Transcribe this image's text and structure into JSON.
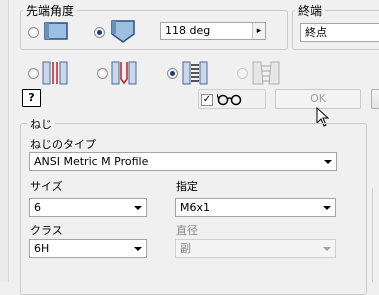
{
  "tip_angle": {
    "title": "先端角度",
    "angle_value": "118 deg",
    "stepper_arrow": "▸"
  },
  "termination": {
    "title": "終端",
    "selected": "終点"
  },
  "hole_types": [
    "simple-hole-icon",
    "clearance-hole-icon",
    "tapped-hole-icon",
    "taper-tapped-hole-icon"
  ],
  "help_button_label": "?",
  "glasses_label": "👓",
  "ok_button_label": "OK",
  "thread": {
    "title": "ねじ",
    "type_label": "ねじのタイプ",
    "type_value": "ANSI Metric M Profile",
    "size_label": "サイズ",
    "size_value": "6",
    "designation_label": "指定",
    "designation_value": "M6x1",
    "class_label": "クラス",
    "class_value": "6H",
    "diameter_label": "直径",
    "diameter_value": "副"
  }
}
